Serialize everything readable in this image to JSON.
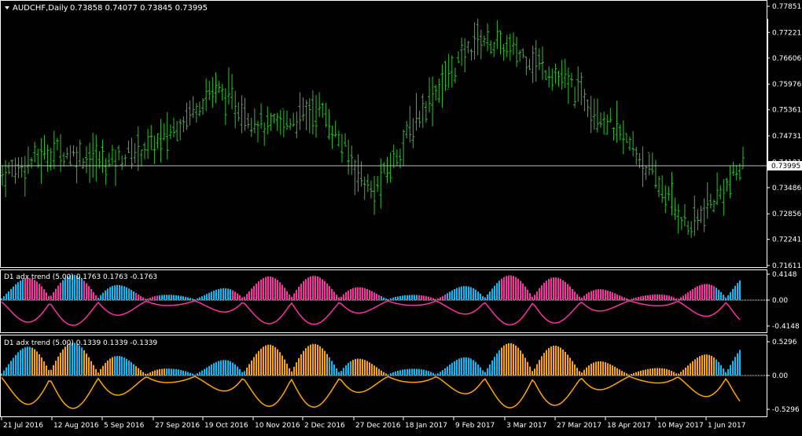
{
  "colors": {
    "background": "#000000",
    "price_bars": "#2fbf2f",
    "grid_frame": "#ffffff",
    "text": "#ffffff",
    "cyan": "#00bfff",
    "magenta": "#ff2fa5",
    "orange": "#ffa500",
    "pink_line": "#ff2fa5"
  },
  "main_panel": {
    "symbol_label": "AUDCHF,Daily",
    "ohlc_label": "0.73858 0.74077 0.73845 0.73995",
    "current_price_label": "0.73995",
    "price_axis_labels": [
      "0.77851",
      "0.77221",
      "0.76606",
      "0.75976",
      "0.75361",
      "0.74731",
      "0.74101",
      "0.73486",
      "0.72856",
      "0.72241",
      "0.71611"
    ]
  },
  "indicator_1": {
    "title": "D1 adx trend (5.00) 0.1763 0.1763 -0.1763",
    "axis_labels": [
      "0.4148",
      "0.00",
      "-0.4148"
    ]
  },
  "indicator_2": {
    "title": "D1 adx trend (5.00) 0.1339 0.1339 -0.1339",
    "axis_labels": [
      "0.5296",
      "0.00",
      "-0.5296"
    ]
  },
  "time_axis_labels": [
    "21 Jul 2016",
    "12 Aug 2016",
    "5 Sep 2016",
    "27 Sep 2016",
    "19 Oct 2016",
    "10 Nov 2016",
    "2 Dec 2016",
    "27 Dec 2016",
    "18 Jan 2017",
    "9 Feb 2017",
    "3 Mar 2017",
    "27 Mar 2017",
    "18 Apr 2017",
    "10 May 2017",
    "1 Jun 2017"
  ],
  "chart_data": {
    "type": "line",
    "title": "AUDCHF,Daily",
    "ylim": [
      0.71611,
      0.77851
    ],
    "categories": [
      "21 Jul 2016",
      "12 Aug 2016",
      "5 Sep 2016",
      "27 Sep 2016",
      "19 Oct 2016",
      "10 Nov 2016",
      "2 Dec 2016",
      "27 Dec 2016",
      "18 Jan 2017",
      "9 Feb 2017",
      "3 Mar 2017",
      "27 Mar 2017",
      "18 Apr 2017",
      "10 May 2017",
      "1 Jun 2017"
    ],
    "series": [
      {
        "name": "AUDCHF",
        "values": [
          0.738,
          0.744,
          0.741,
          0.746,
          0.759,
          0.749,
          0.754,
          0.733,
          0.755,
          0.771,
          0.766,
          0.757,
          0.743,
          0.725,
          0.74
        ]
      }
    ]
  }
}
